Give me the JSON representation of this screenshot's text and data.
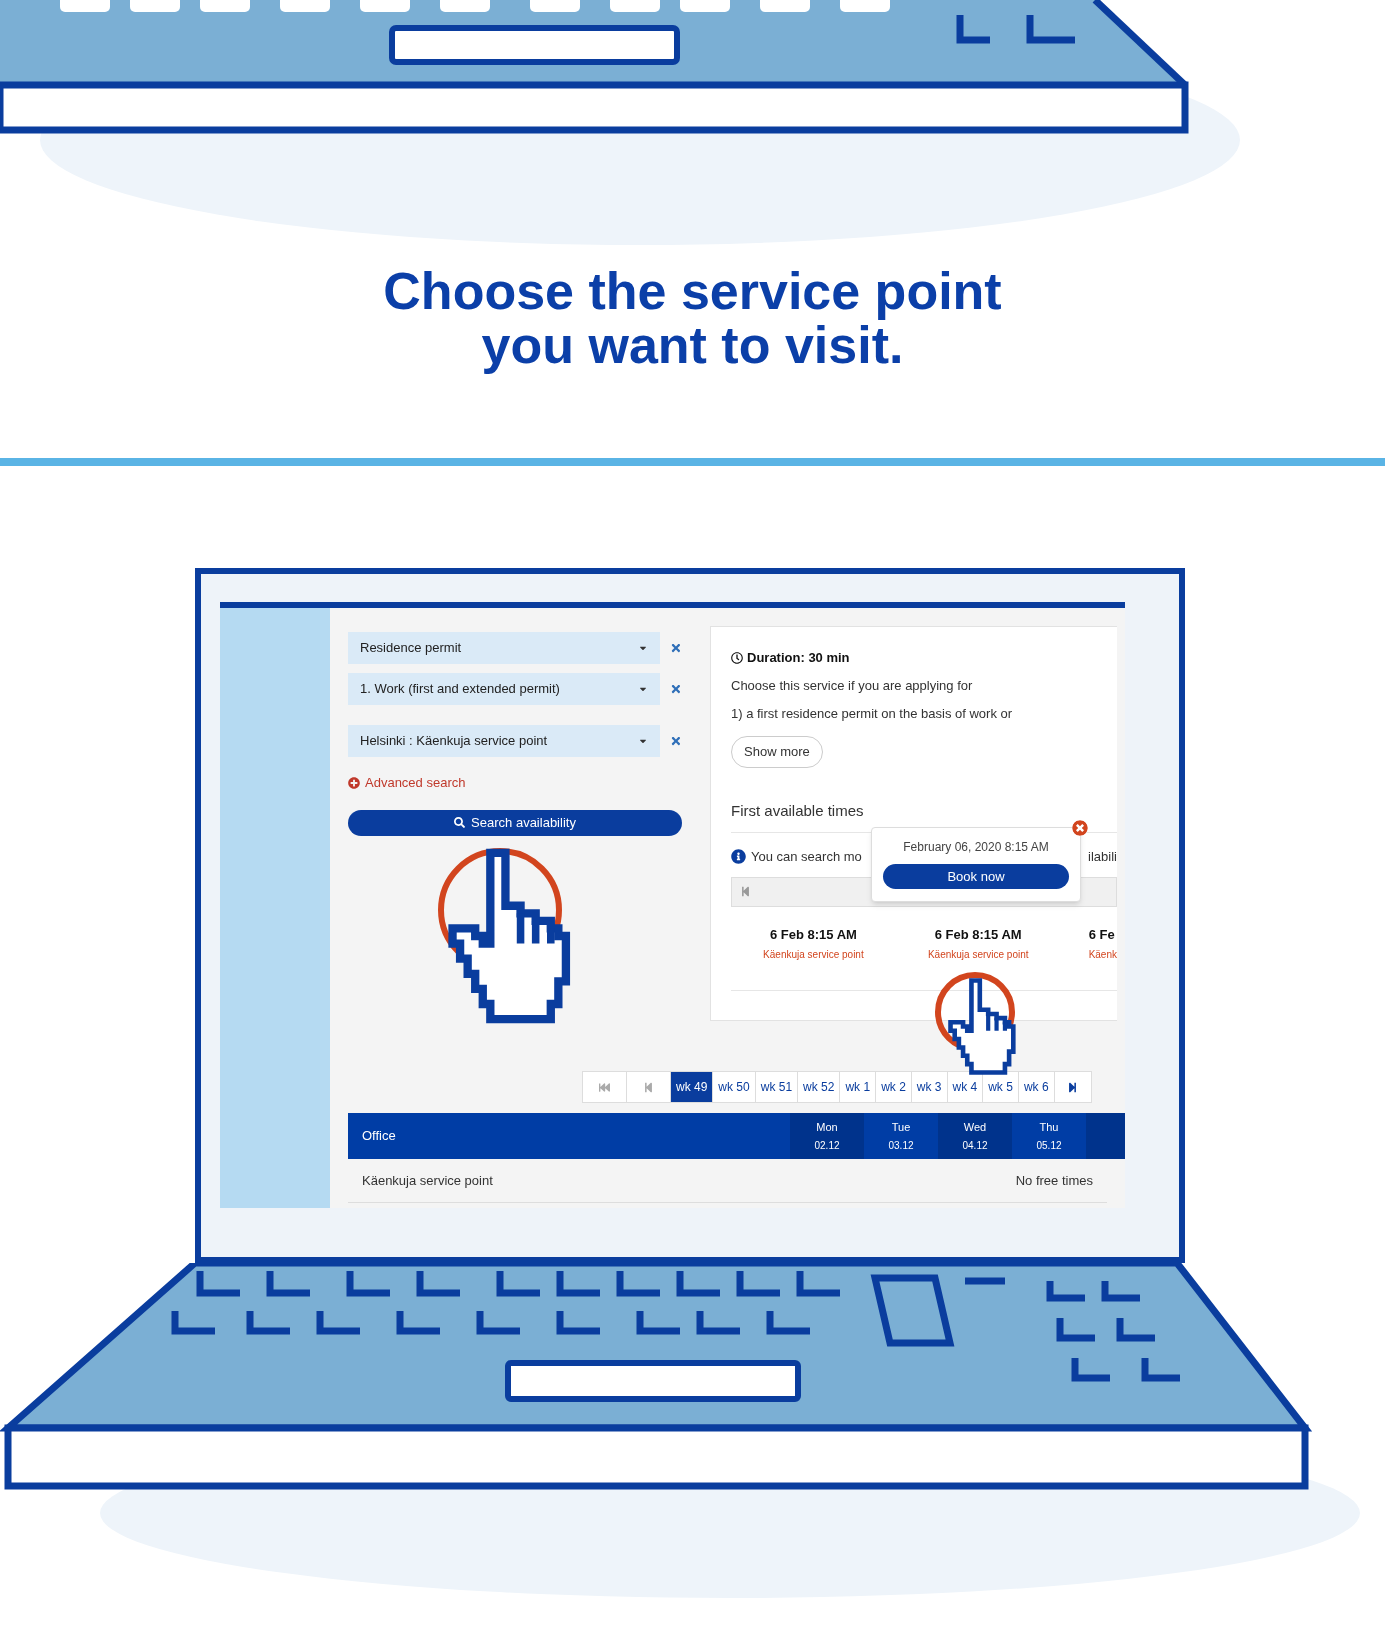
{
  "heading": {
    "lines": [
      "Choose the service point",
      "you want to visit."
    ]
  },
  "screen": {
    "service_selects": [
      {
        "value": "Residence permit"
      },
      {
        "value": "1. Work (first and extended permit)"
      }
    ],
    "location_select": {
      "value": "Helsinki : Käenkuja service point"
    },
    "advanced_search": "Advanced search",
    "search_button": "Search availability",
    "service_card": {
      "duration": "Duration: 30 min",
      "description": [
        "Choose this service if you are applying for",
        "1) a first residence permit on the basis of work or"
      ],
      "show_more": "Show more",
      "first_available_title": "First available times",
      "info_text": "You can search mo",
      "info_text_right": "ilabili",
      "times": [
        {
          "time": "6 Feb 8:15 AM",
          "place": "Käenkuja service point"
        },
        {
          "time": "6 Feb 8:15 AM",
          "place": "Käenkuja service point"
        },
        {
          "time": "6 Fe",
          "place": "Käenk"
        }
      ],
      "tooltip": {
        "date": "February 06, 2020 8:15 AM",
        "button": "Book now"
      }
    },
    "pager": {
      "first": {
        "disabled": true
      },
      "prev": {
        "disabled": true
      },
      "weeks": [
        {
          "label": "wk 49",
          "selected": true
        },
        {
          "label": "wk 50",
          "selected": false
        },
        {
          "label": "wk 51",
          "selected": false
        },
        {
          "label": "wk 52",
          "selected": false
        },
        {
          "label": "wk 1",
          "selected": false
        },
        {
          "label": "wk 2",
          "selected": false
        },
        {
          "label": "wk 3",
          "selected": false
        },
        {
          "label": "wk 4",
          "selected": false
        },
        {
          "label": "wk 5",
          "selected": false
        },
        {
          "label": "wk 6",
          "selected": false
        }
      ],
      "next": {
        "disabled": false
      }
    },
    "table": {
      "office_header": "Office",
      "days": [
        {
          "day": "Mon",
          "date": "02.12"
        },
        {
          "day": "Tue",
          "date": "03.12"
        },
        {
          "day": "Wed",
          "date": "04.12"
        },
        {
          "day": "Thu",
          "date": "05.12"
        }
      ],
      "rows": [
        {
          "office": "Käenkuja service point",
          "status": "No free times"
        }
      ]
    }
  }
}
